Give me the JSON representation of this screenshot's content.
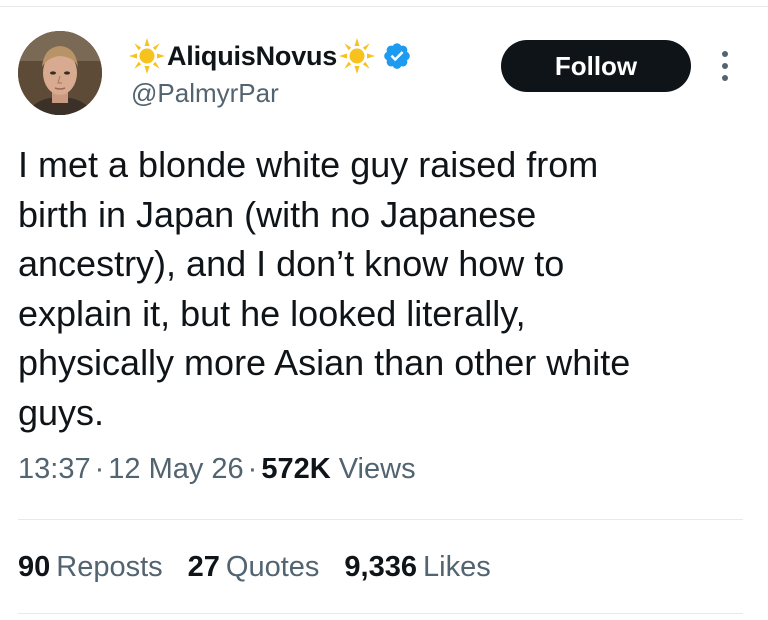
{
  "author": {
    "display_name": "AliquisNovus",
    "handle": "@PalmyrPar",
    "name_prefix_icon": "sun-emoji-icon",
    "name_suffix_icon": "sun-emoji-icon",
    "badge_icon": "verified-badge-icon",
    "badge_color": "#1d9bf0"
  },
  "follow_label": "Follow",
  "more_icon": "more-options-icon",
  "tweet": {
    "text": "I met a blonde white guy raised from\nbirth in Japan (with no Japanese\nancestry), and I don’t know how to\nexplain it, but he looked literally,\nphysically more Asian than other white\nguys."
  },
  "meta": {
    "time": "13:37",
    "date": "12 May 26",
    "views_count": "572K",
    "views_label": "Views",
    "separator": "·"
  },
  "stats": [
    {
      "count": "90",
      "label": "Reposts"
    },
    {
      "count": "27",
      "label": "Quotes"
    },
    {
      "count": "9,336",
      "label": "Likes"
    }
  ],
  "colors": {
    "text_primary": "#0f1419",
    "text_secondary": "#536471",
    "divider": "#e7e9ea",
    "button_bg": "#0f1419",
    "sun": "#f7c11e"
  }
}
